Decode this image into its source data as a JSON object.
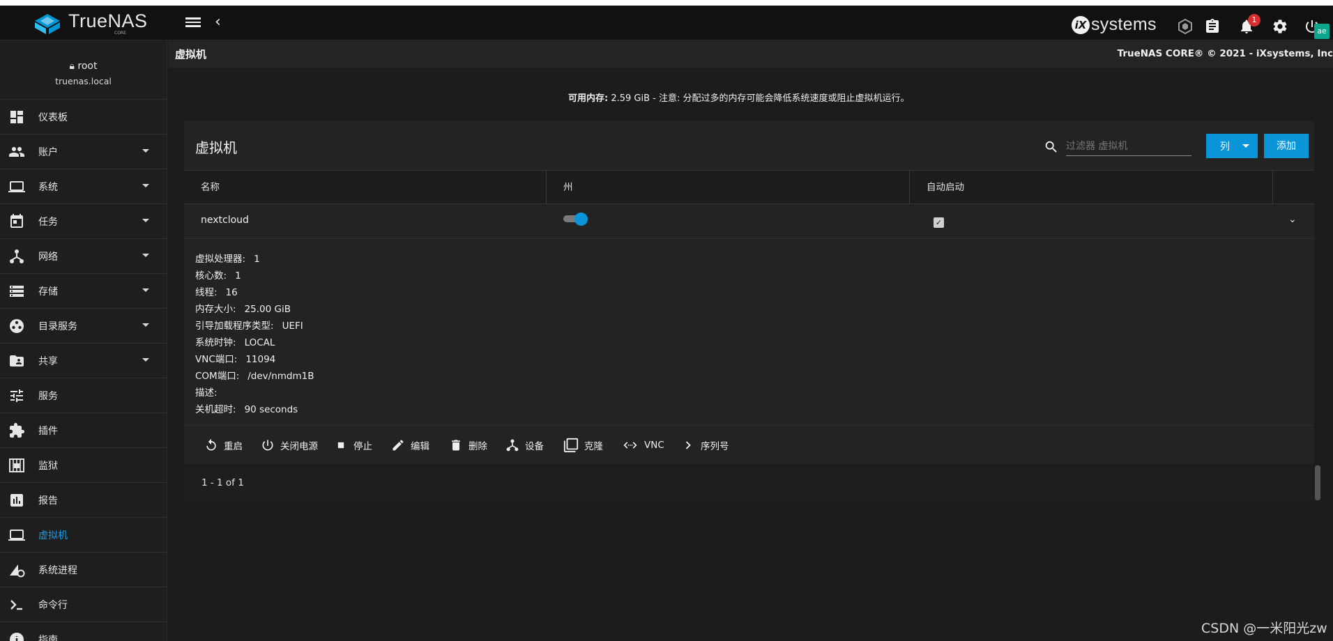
{
  "app": {
    "logo_text": "TrueNAS",
    "logo_sub": "CORE",
    "vendor_text": "systems"
  },
  "header": {
    "notification_count": "1",
    "avatar_text": "ae"
  },
  "user": {
    "name": "root",
    "host": "truenas.local"
  },
  "sidebar": {
    "items": [
      {
        "label": "仪表板",
        "icon": "dashboard-icon",
        "expandable": false
      },
      {
        "label": "账户",
        "icon": "people-icon",
        "expandable": true
      },
      {
        "label": "系统",
        "icon": "laptop-icon",
        "expandable": true
      },
      {
        "label": "任务",
        "icon": "calendar-icon",
        "expandable": true
      },
      {
        "label": "网络",
        "icon": "network-icon",
        "expandable": true
      },
      {
        "label": "存储",
        "icon": "storage-icon",
        "expandable": true
      },
      {
        "label": "目录服务",
        "icon": "directory-icon",
        "expandable": true
      },
      {
        "label": "共享",
        "icon": "folder-share-icon",
        "expandable": true
      },
      {
        "label": "服务",
        "icon": "sliders-icon",
        "expandable": false
      },
      {
        "label": "插件",
        "icon": "puzzle-icon",
        "expandable": false
      },
      {
        "label": "监狱",
        "icon": "jail-icon",
        "expandable": false
      },
      {
        "label": "报告",
        "icon": "chart-icon",
        "expandable": false
      },
      {
        "label": "虚拟机",
        "icon": "computer-icon",
        "expandable": false,
        "active": true
      },
      {
        "label": "系统进程",
        "icon": "process-icon",
        "expandable": false
      },
      {
        "label": "命令行",
        "icon": "terminal-icon",
        "expandable": false
      },
      {
        "label": "指南",
        "icon": "info-icon",
        "expandable": false
      }
    ]
  },
  "page": {
    "title": "虚拟机",
    "copyright": "TrueNAS CORE® © 2021 - iXsystems, Inc",
    "memory_label": "可用内存:",
    "memory_value": "2.59 GiB - 注意: 分配过多的内存可能会降低系统速度或阻止虚拟机运行。"
  },
  "table": {
    "title": "虚拟机",
    "search_placeholder": "过滤器 虚拟机",
    "columns_button": "列",
    "add_button": "添加",
    "headers": [
      "名称",
      "州",
      "自动启动"
    ],
    "rows": [
      {
        "name": "nextcloud",
        "state_on": true,
        "autostart": true
      }
    ],
    "details": [
      {
        "key": "虚拟处理器:",
        "value": "1"
      },
      {
        "key": "核心数:",
        "value": "1"
      },
      {
        "key": "线程:",
        "value": "16"
      },
      {
        "key": "内存大小:",
        "value": "25.00 GiB"
      },
      {
        "key": "引导加载程序类型:",
        "value": "UEFI"
      },
      {
        "key": "系统时钟:",
        "value": "LOCAL"
      },
      {
        "key": "VNC端口:",
        "value": "11094"
      },
      {
        "key": "COM端口:",
        "value": "/dev/nmdm1B"
      },
      {
        "key": "描述:",
        "value": ""
      },
      {
        "key": "关机超时:",
        "value": "90 seconds"
      }
    ],
    "actions": [
      "重启",
      "关闭电源",
      "停止",
      "编辑",
      "删除",
      "设备",
      "克隆",
      "VNC",
      "序列号"
    ],
    "pagination": "1 - 1 of 1"
  },
  "watermark": "CSDN @一米阳光zw",
  "colors": {
    "accent": "#0a95d8",
    "active_nav": "#1e9be0",
    "badge": "#d32f2f"
  }
}
